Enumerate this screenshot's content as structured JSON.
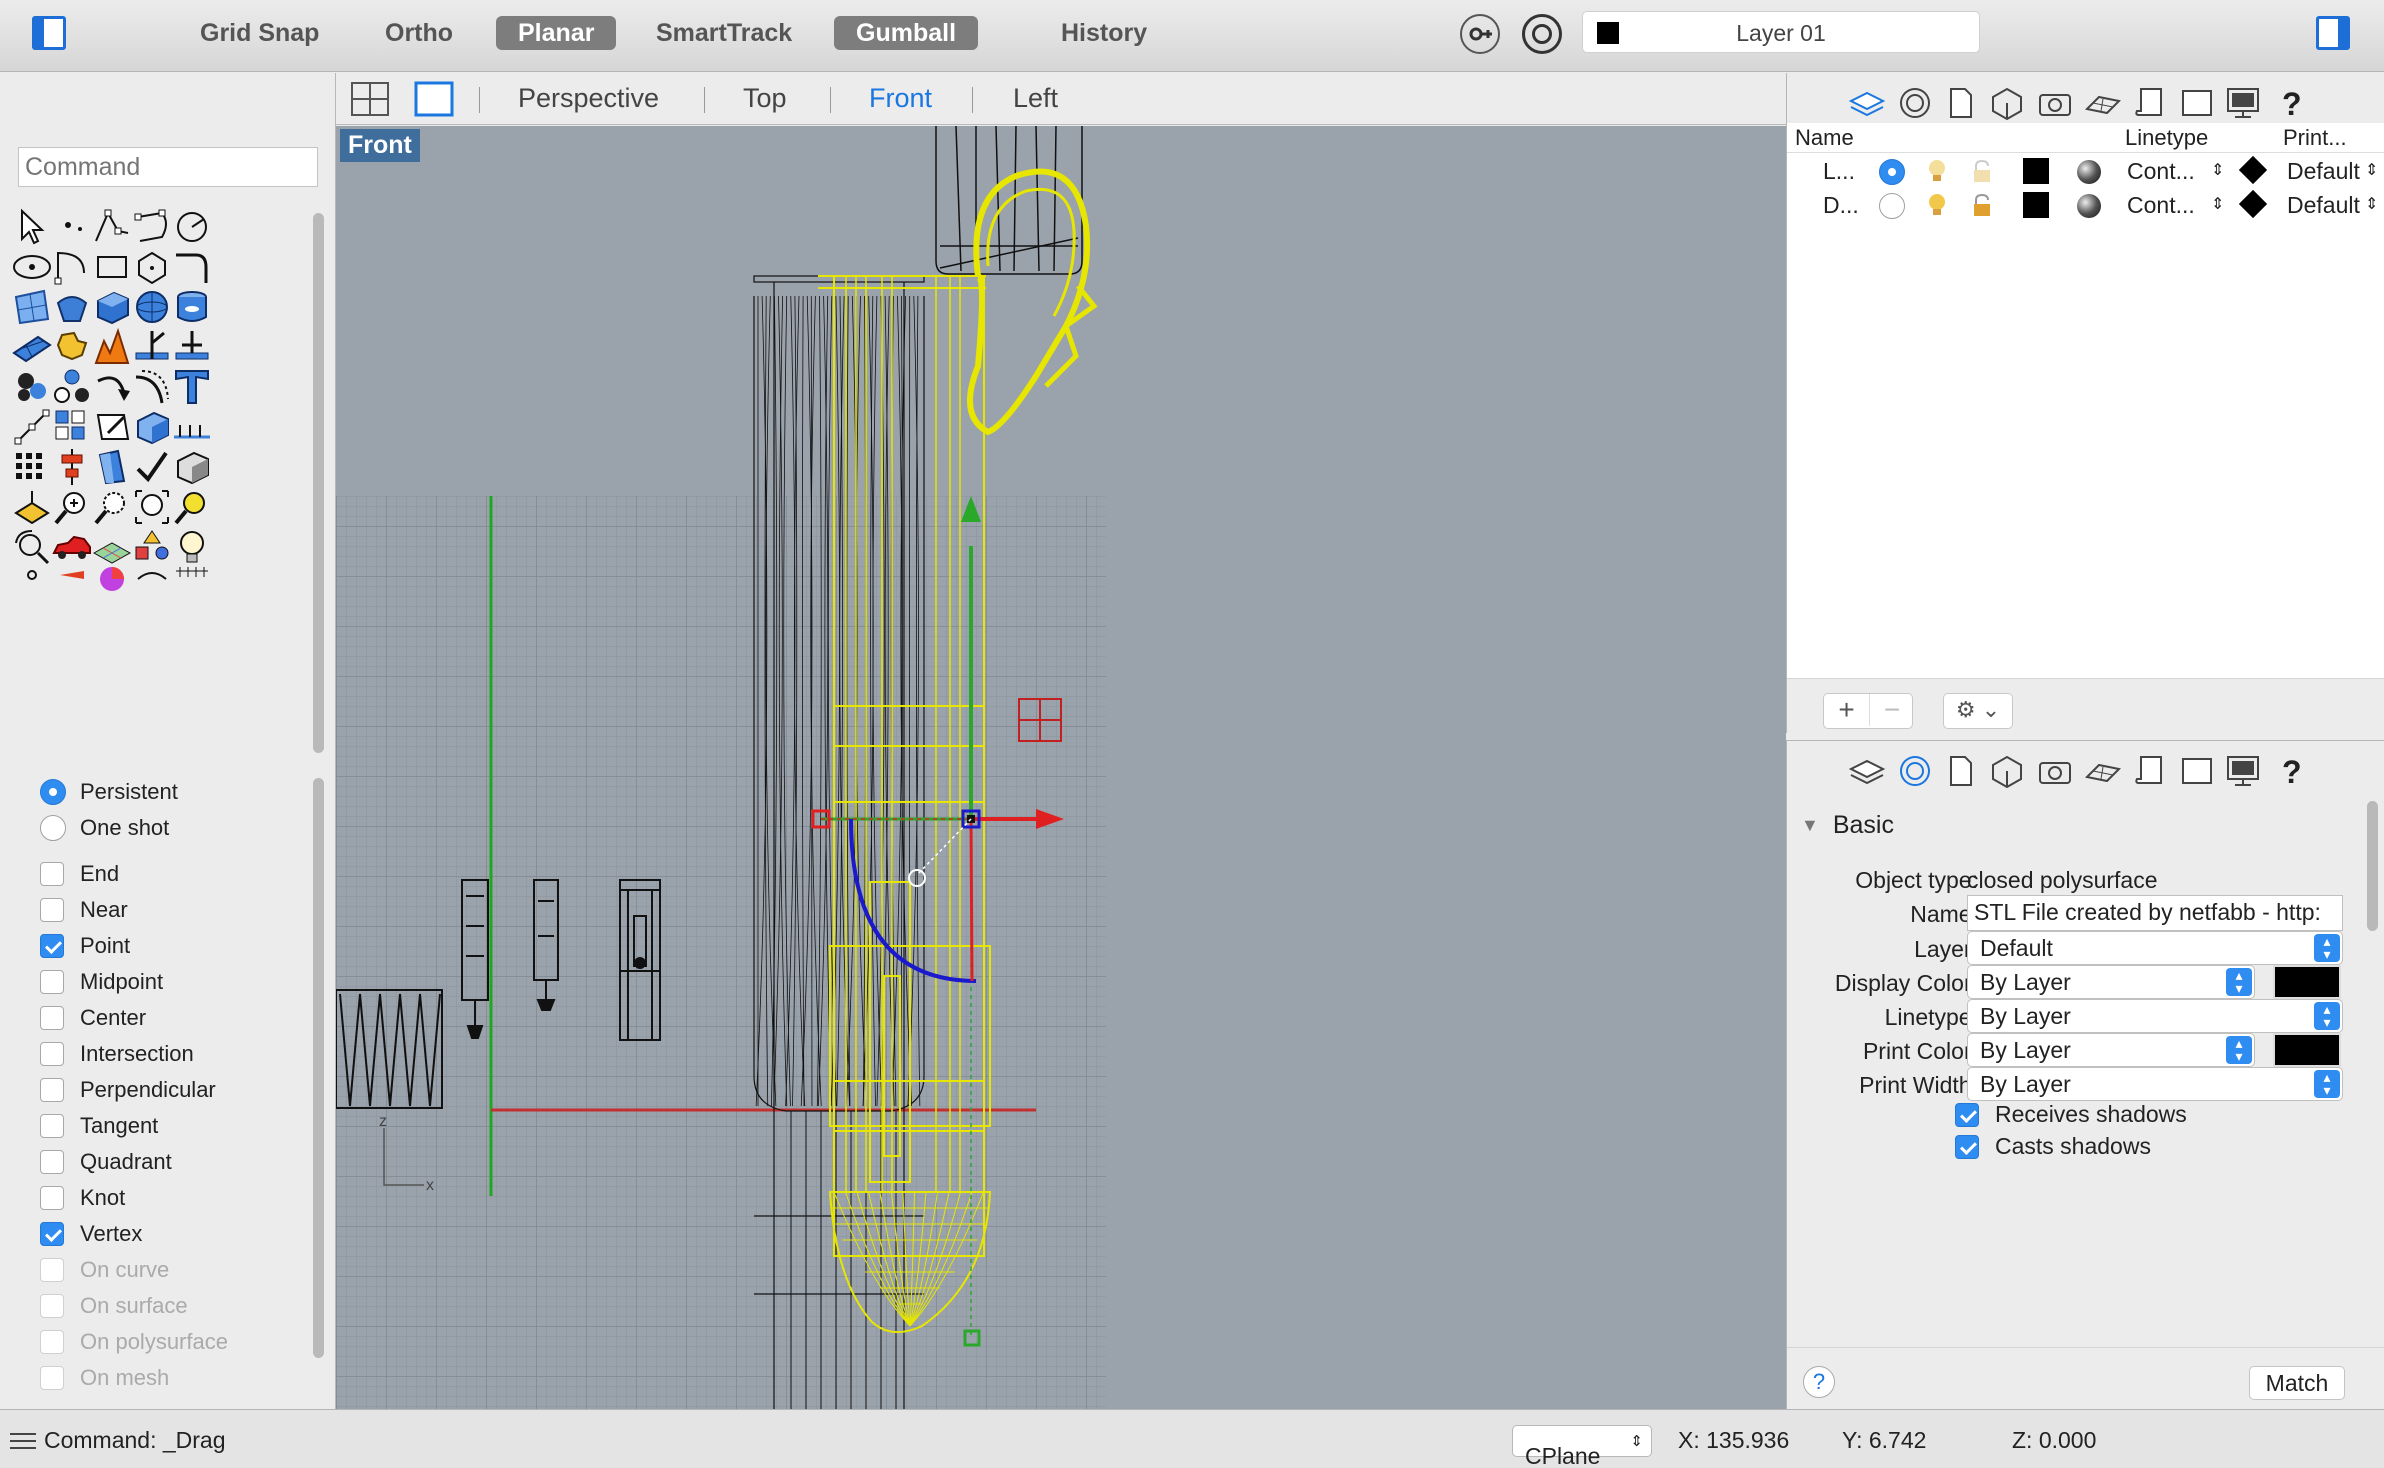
{
  "toolbar": {
    "modes": [
      {
        "label": "Grid Snap",
        "active": false
      },
      {
        "label": "Ortho",
        "active": false
      },
      {
        "label": "Planar",
        "active": true
      },
      {
        "label": "SmartTrack",
        "active": false
      },
      {
        "label": "Gumball",
        "active": true
      },
      {
        "label": "History",
        "active": false
      }
    ],
    "current_layer": "Layer 01"
  },
  "command": {
    "placeholder": "Command"
  },
  "osnap": {
    "mode": [
      {
        "label": "Persistent",
        "selected": true
      },
      {
        "label": "One shot",
        "selected": false
      }
    ],
    "items": [
      {
        "label": "End",
        "checked": false,
        "enabled": true
      },
      {
        "label": "Near",
        "checked": false,
        "enabled": true
      },
      {
        "label": "Point",
        "checked": true,
        "enabled": true
      },
      {
        "label": "Midpoint",
        "checked": false,
        "enabled": true
      },
      {
        "label": "Center",
        "checked": false,
        "enabled": true
      },
      {
        "label": "Intersection",
        "checked": false,
        "enabled": true
      },
      {
        "label": "Perpendicular",
        "checked": false,
        "enabled": true
      },
      {
        "label": "Tangent",
        "checked": false,
        "enabled": true
      },
      {
        "label": "Quadrant",
        "checked": false,
        "enabled": true
      },
      {
        "label": "Knot",
        "checked": false,
        "enabled": true
      },
      {
        "label": "Vertex",
        "checked": true,
        "enabled": true
      },
      {
        "label": "On curve",
        "checked": false,
        "enabled": false
      },
      {
        "label": "On surface",
        "checked": false,
        "enabled": false
      },
      {
        "label": "On polysurface",
        "checked": false,
        "enabled": false
      },
      {
        "label": "On mesh",
        "checked": false,
        "enabled": false
      }
    ]
  },
  "viewport": {
    "tabs": [
      {
        "label": "Perspective",
        "active": false
      },
      {
        "label": "Top",
        "active": false
      },
      {
        "label": "Front",
        "active": true
      },
      {
        "label": "Left",
        "active": false
      }
    ],
    "label": "Front",
    "axis_z": "z",
    "axis_x": "x"
  },
  "layers": {
    "headers": {
      "name": "Name",
      "linetype": "Linetype",
      "print": "Print..."
    },
    "rows": [
      {
        "name": "L...",
        "current": true,
        "linetype": "Cont...",
        "print": "Default"
      },
      {
        "name": "D...",
        "current": false,
        "linetype": "Cont...",
        "print": "Default"
      }
    ]
  },
  "properties": {
    "section": "Basic",
    "object_type_label": "Object type:",
    "object_type": "closed polysurface",
    "name_label": "Name:",
    "name": "STL File created by netfabb - http:",
    "layer_label": "Layer:",
    "layer": "Default",
    "display_color_label": "Display Color:",
    "display_color": "By Layer",
    "linetype_label": "Linetype:",
    "linetype": "By Layer",
    "print_color_label": "Print Color:",
    "print_color": "By Layer",
    "print_width_label": "Print Width:",
    "print_width": "By Layer",
    "receives_shadows": "Receives shadows",
    "casts_shadows": "Casts shadows",
    "help": "?",
    "match": "Match"
  },
  "status": {
    "command": "Command: _Drag",
    "cplane": "CPlane",
    "x": "X: 135.936",
    "y": "Y: 6.742",
    "z": "Z: 0.000"
  },
  "colors": {
    "accent": "#2f8cf0",
    "viewport_bg": "#9aa2ac",
    "selected_object": "#e6e600",
    "viewport_label": "#3f6e9d"
  }
}
